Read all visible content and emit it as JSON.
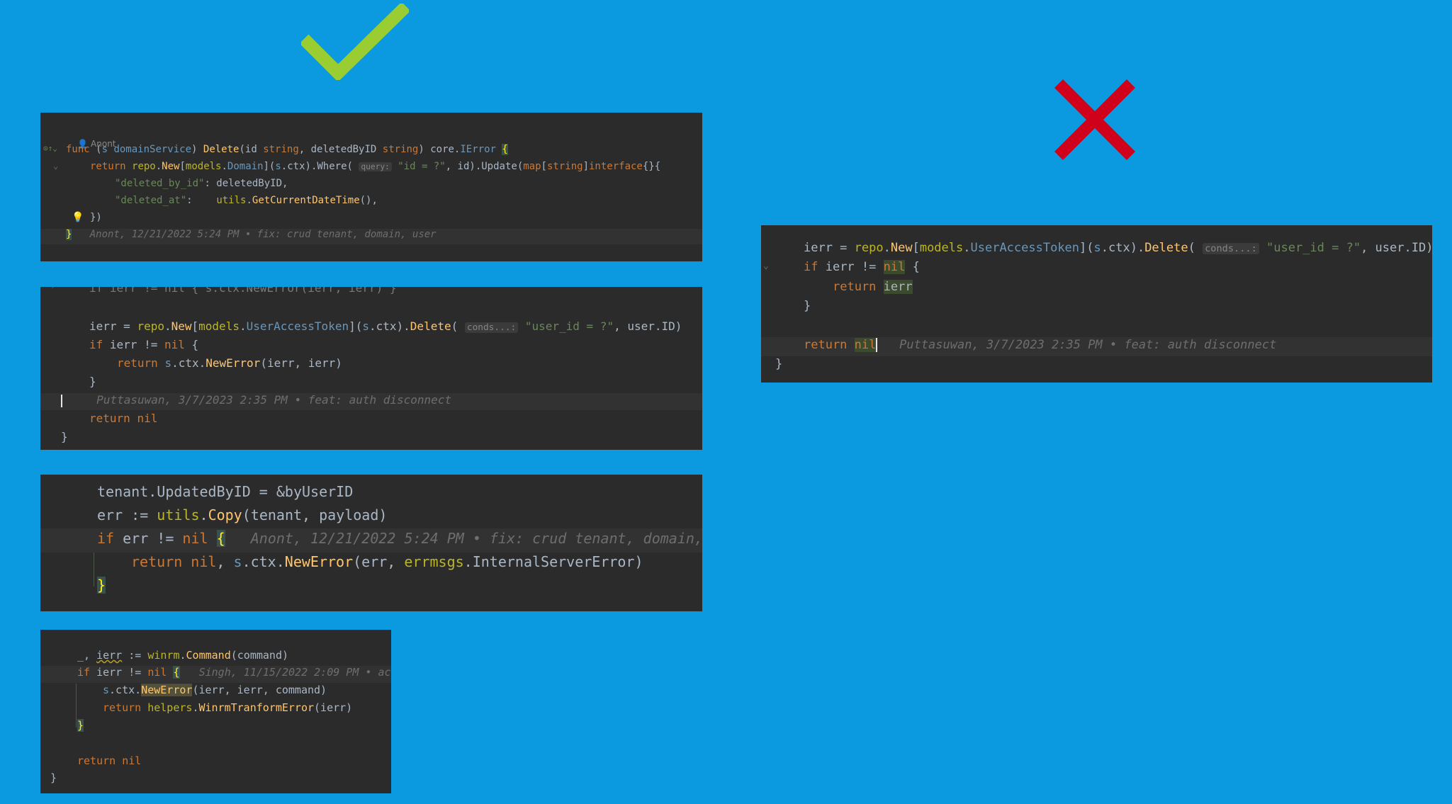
{
  "panel1": {
    "author_label": "Anont",
    "blame": "Anont, 12/21/2022 5:24 PM • fix: crud tenant, domain, user",
    "hint_query": "query:"
  },
  "panel2": {
    "top_partial": "if ierr != nil { s.ctx.NewError(ierr, ierr) }",
    "hint_conds": "conds...:",
    "blame": "Puttasuwan, 3/7/2023 2:35 PM • feat: auth disconnect"
  },
  "panel3": {
    "blame": "Anont, 12/21/2022 5:24 PM • fix: crud tenant, domain,"
  },
  "panel4": {
    "blame": "Singh, 11/15/2022 2:09 PM • ac"
  },
  "panel5": {
    "hint_conds": "conds...:",
    "blame": "Puttasuwan, 3/7/2023 2:35 PM • feat: auth disconnect"
  },
  "colors": {
    "background": "#0b9ae0",
    "check": "#9acd32",
    "cross": "#d0021b",
    "editor": "#2b2b2b"
  },
  "icons": {
    "good": "check-icon",
    "bad": "cross-icon"
  }
}
